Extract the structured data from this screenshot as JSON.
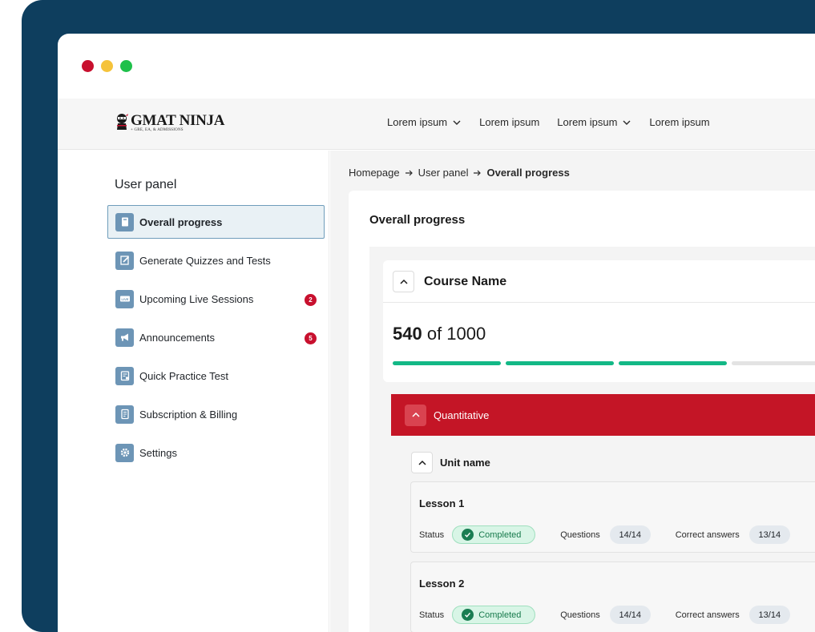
{
  "nav": {
    "logo_title": "GMAT NINJA",
    "logo_subtitle": "+ GRE, EA, & ADMISSIONS",
    "items": [
      {
        "label": "Lorem ipsum",
        "has_dropdown": true
      },
      {
        "label": "Lorem ipsum",
        "has_dropdown": false
      },
      {
        "label": "Lorem ipsum",
        "has_dropdown": true
      },
      {
        "label": "Lorem ipsum",
        "has_dropdown": false
      }
    ]
  },
  "sidebar": {
    "title": "User panel",
    "items": [
      {
        "label": "Overall progress",
        "icon": "book-icon",
        "active": true
      },
      {
        "label": "Generate Quizzes and Tests",
        "icon": "edit-icon"
      },
      {
        "label": "Upcoming Live Sessions",
        "icon": "live-icon",
        "badge": "2"
      },
      {
        "label": "Announcements",
        "icon": "megaphone-icon",
        "badge": "5"
      },
      {
        "label": "Quick Practice Test",
        "icon": "clipboard-icon"
      },
      {
        "label": "Subscription & Billing",
        "icon": "document-icon"
      },
      {
        "label": "Settings",
        "icon": "gear-icon"
      }
    ]
  },
  "breadcrumb": {
    "items": [
      "Homepage",
      "User panel",
      "Overall progress"
    ]
  },
  "main": {
    "title": "Overall progress",
    "course": {
      "name": "Course Name",
      "score": "540",
      "score_of": "of 1000",
      "progress_segments_filled": 3,
      "progress_segments_total": 4
    },
    "section": {
      "label": "Quantitative"
    },
    "unit": {
      "name": "Unit name"
    },
    "lessons": [
      {
        "title": "Lesson 1",
        "status_label": "Status",
        "status": "Completed",
        "questions_label": "Questions",
        "questions": "14/14",
        "correct_label": "Correct answers",
        "correct": "13/14"
      },
      {
        "title": "Lesson 2",
        "status_label": "Status",
        "status": "Completed",
        "questions_label": "Questions",
        "questions": "14/14",
        "correct_label": "Correct answers",
        "correct": "13/14"
      }
    ]
  },
  "colors": {
    "frame": "#0e3e5e",
    "accent_red": "#c41526",
    "progress_green": "#13b886",
    "sidebar_icon": "#6d95b6"
  }
}
